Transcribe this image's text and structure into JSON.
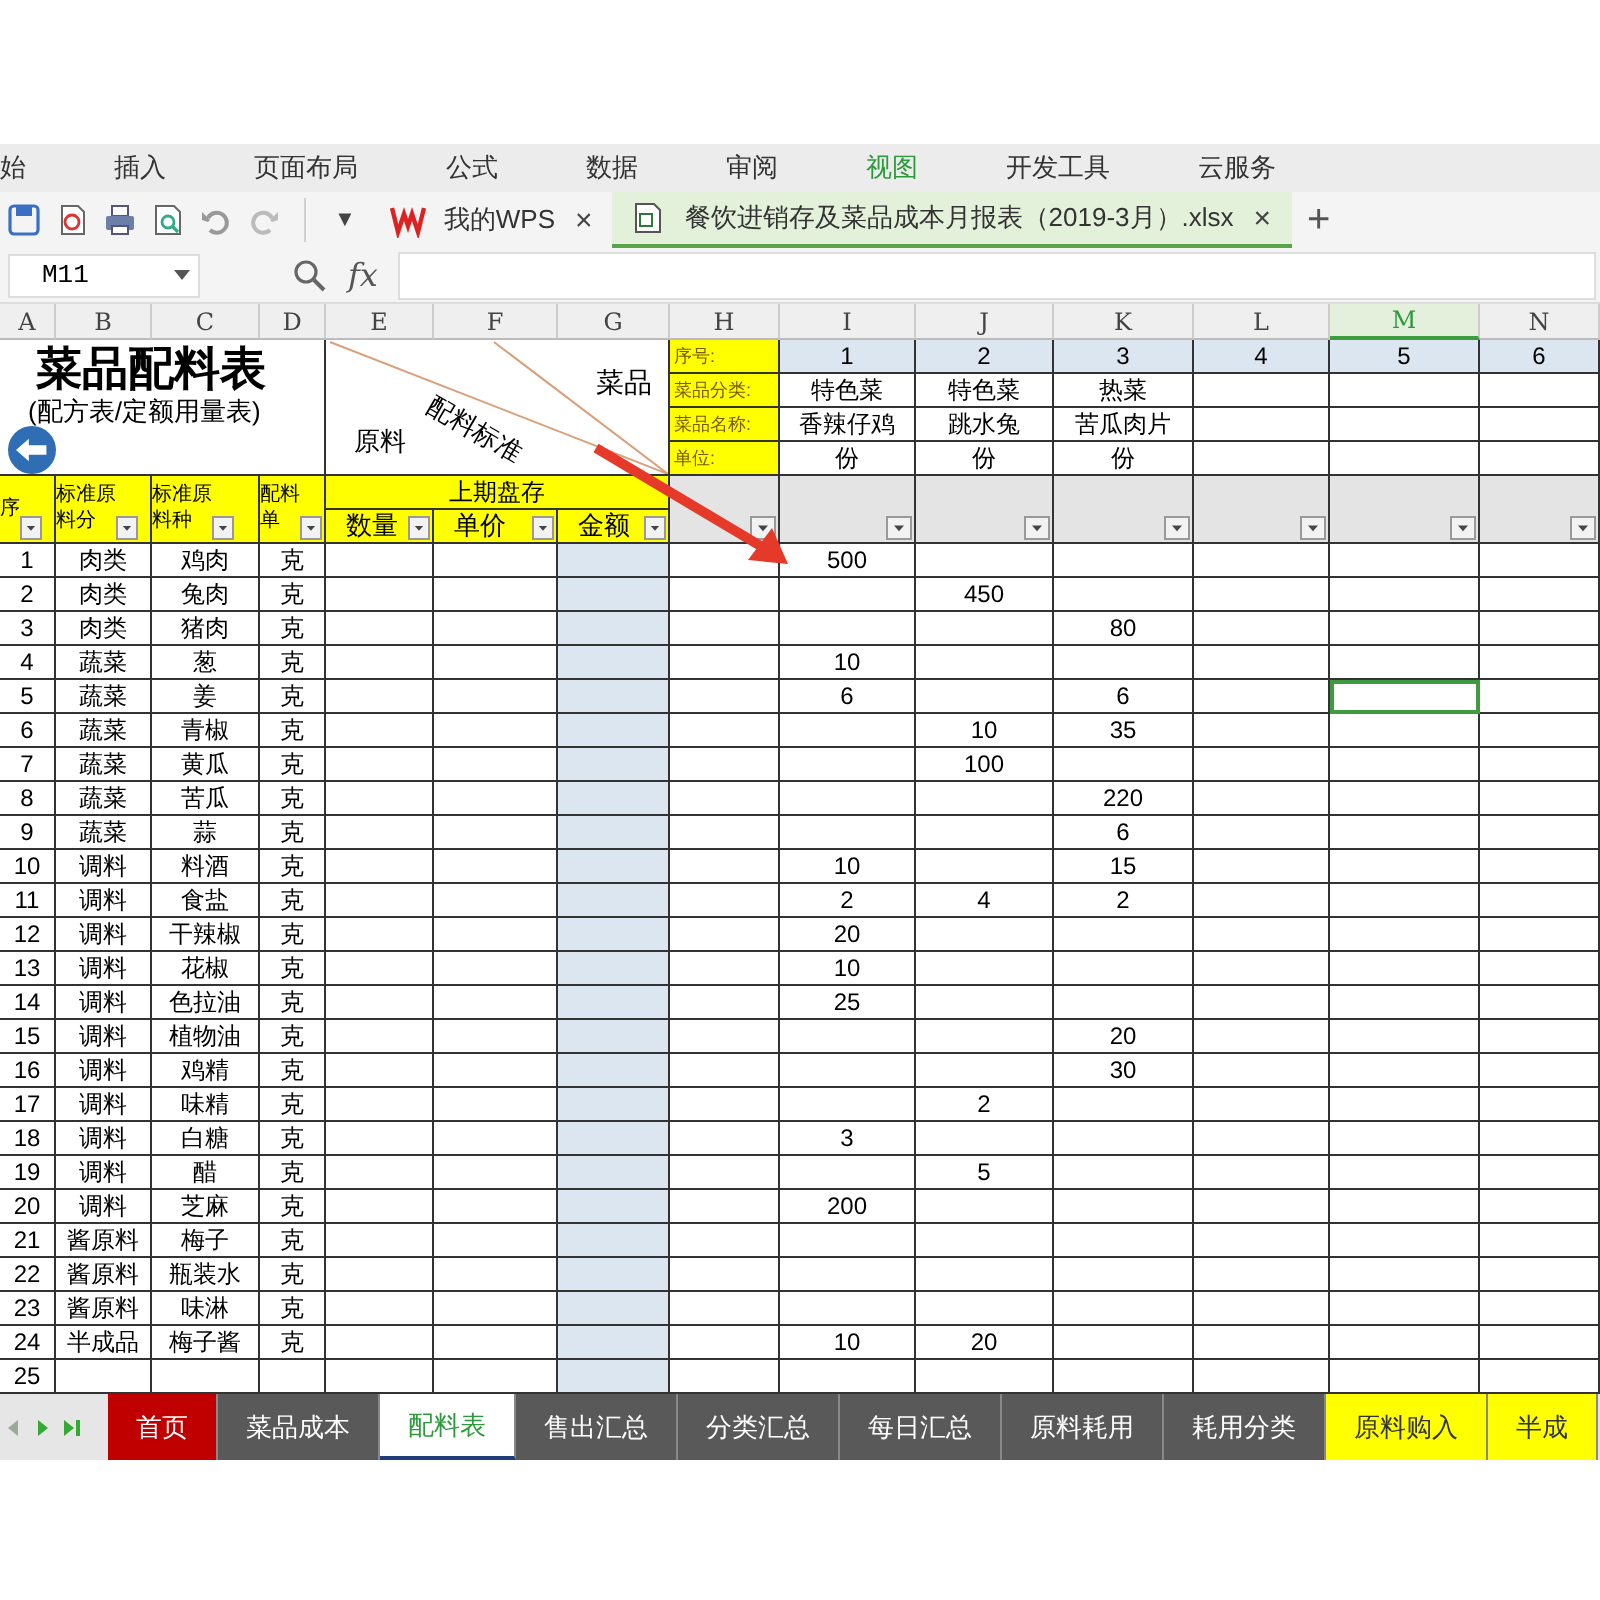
{
  "menu": [
    {
      "label": "始",
      "selected": false
    },
    {
      "label": "插入",
      "selected": false
    },
    {
      "label": "页面布局",
      "selected": false
    },
    {
      "label": "公式",
      "selected": false
    },
    {
      "label": "数据",
      "selected": false
    },
    {
      "label": "审阅",
      "selected": false
    },
    {
      "label": "视图",
      "selected": true
    },
    {
      "label": "开发工具",
      "selected": false
    },
    {
      "label": "云服务",
      "selected": false
    }
  ],
  "toolbar": {
    "more": "▼",
    "doc_tabs": [
      {
        "label": "我的WPS",
        "kind": "home",
        "selected": false,
        "close": "×"
      },
      {
        "label": "餐饮进销存及菜品成本月报表（2019-3月）.xlsx",
        "kind": "file",
        "selected": true,
        "close": "×"
      }
    ],
    "new_tab": "+"
  },
  "formula_bar": {
    "name_box": "M11",
    "fx": "fx"
  },
  "sheet": {
    "columns": [
      {
        "letter": "A",
        "selected": false
      },
      {
        "letter": "B",
        "selected": false
      },
      {
        "letter": "C",
        "selected": false
      },
      {
        "letter": "D",
        "selected": false
      },
      {
        "letter": "E",
        "selected": false
      },
      {
        "letter": "F",
        "selected": false
      },
      {
        "letter": "G",
        "selected": false
      },
      {
        "letter": "H",
        "selected": false
      },
      {
        "letter": "I",
        "selected": false
      },
      {
        "letter": "J",
        "selected": false
      },
      {
        "letter": "K",
        "selected": false
      },
      {
        "letter": "L",
        "selected": false
      },
      {
        "letter": "M",
        "selected": true
      },
      {
        "letter": "N",
        "selected": false
      }
    ],
    "title": "菜品配料表",
    "subtitle": "(配方表/定额用量表)",
    "diagonal_header": {
      "top": "菜品",
      "middle": "配料标准",
      "bottom": "原料"
    },
    "dish_labels": [
      "序号:",
      "菜品分类:",
      "菜品名称:",
      "单位:"
    ],
    "dishes": [
      {
        "no": "1",
        "category": "特色菜",
        "name": "香辣仔鸡",
        "unit": "份"
      },
      {
        "no": "2",
        "category": "特色菜",
        "name": "跳水兔",
        "unit": "份"
      },
      {
        "no": "3",
        "category": "热菜",
        "name": "苦瓜肉片",
        "unit": "份"
      },
      {
        "no": "4"
      },
      {
        "no": "5"
      },
      {
        "no": "6"
      }
    ],
    "headers": [
      [
        "序"
      ],
      [
        "标准原",
        "料分"
      ],
      [
        "标准原",
        "料种"
      ],
      [
        "配料",
        "单"
      ]
    ],
    "stock_header": "上期盘存",
    "stock_columns": [
      "数量",
      "单价",
      "金额"
    ],
    "rows": [
      {
        "no": "1",
        "category": "肉类",
        "material": "鸡肉",
        "unit": "克",
        "dish_1": "500",
        "active": false
      },
      {
        "no": "2",
        "category": "肉类",
        "material": "兔肉",
        "unit": "克",
        "dish_2": "450",
        "active": false
      },
      {
        "no": "3",
        "category": "肉类",
        "material": "猪肉",
        "unit": "克",
        "dish_3": "80",
        "active": false
      },
      {
        "no": "4",
        "category": "蔬菜",
        "material": "葱",
        "unit": "克",
        "dish_1": "10",
        "active": false
      },
      {
        "no": "5",
        "category": "蔬菜",
        "material": "姜",
        "unit": "克",
        "dish_1": "6",
        "dish_3": "6",
        "active": true
      },
      {
        "no": "6",
        "category": "蔬菜",
        "material": "青椒",
        "unit": "克",
        "dish_2": "10",
        "dish_3": "35",
        "active": false
      },
      {
        "no": "7",
        "category": "蔬菜",
        "material": "黄瓜",
        "unit": "克",
        "dish_2": "100",
        "active": false
      },
      {
        "no": "8",
        "category": "蔬菜",
        "material": "苦瓜",
        "unit": "克",
        "dish_3": "220",
        "active": false
      },
      {
        "no": "9",
        "category": "蔬菜",
        "material": "蒜",
        "unit": "克",
        "dish_3": "6",
        "active": false
      },
      {
        "no": "10",
        "category": "调料",
        "material": "料酒",
        "unit": "克",
        "dish_1": "10",
        "dish_3": "15",
        "active": false
      },
      {
        "no": "11",
        "category": "调料",
        "material": "食盐",
        "unit": "克",
        "dish_1": "2",
        "dish_2": "4",
        "dish_3": "2",
        "active": false
      },
      {
        "no": "12",
        "category": "调料",
        "material": "干辣椒",
        "unit": "克",
        "dish_1": "20",
        "active": false
      },
      {
        "no": "13",
        "category": "调料",
        "material": "花椒",
        "unit": "克",
        "dish_1": "10",
        "active": false
      },
      {
        "no": "14",
        "category": "调料",
        "material": "色拉油",
        "unit": "克",
        "dish_1": "25",
        "active": false
      },
      {
        "no": "15",
        "category": "调料",
        "material": "植物油",
        "unit": "克",
        "dish_3": "20",
        "active": false
      },
      {
        "no": "16",
        "category": "调料",
        "material": "鸡精",
        "unit": "克",
        "dish_3": "30",
        "active": false
      },
      {
        "no": "17",
        "category": "调料",
        "material": "味精",
        "unit": "克",
        "dish_2": "2",
        "active": false
      },
      {
        "no": "18",
        "category": "调料",
        "material": "白糖",
        "unit": "克",
        "dish_1": "3",
        "active": false
      },
      {
        "no": "19",
        "category": "调料",
        "material": "醋",
        "unit": "克",
        "dish_2": "5",
        "active": false
      },
      {
        "no": "20",
        "category": "调料",
        "material": "芝麻",
        "unit": "克",
        "dish_1": "200",
        "active": false
      },
      {
        "no": "21",
        "category": "酱原料",
        "material": "梅子",
        "unit": "克",
        "active": false
      },
      {
        "no": "22",
        "category": "酱原料",
        "material": "瓶装水",
        "unit": "克",
        "active": false
      },
      {
        "no": "23",
        "category": "酱原料",
        "material": "味淋",
        "unit": "克",
        "active": false
      },
      {
        "no": "24",
        "category": "半成品",
        "material": "梅子酱",
        "unit": "克",
        "dish_1": "10",
        "dish_2": "20",
        "active": false
      },
      {
        "no": "25",
        "active": false
      }
    ]
  },
  "sheet_tabs": [
    {
      "label": "首页",
      "color": "#c00000",
      "selected": false
    },
    {
      "label": "菜品成本",
      "color": "#595959",
      "selected": false
    },
    {
      "label": "配料表",
      "color": "#ffffff",
      "selected": true
    },
    {
      "label": "售出汇总",
      "color": "#595959",
      "selected": false
    },
    {
      "label": "分类汇总",
      "color": "#595959",
      "selected": false
    },
    {
      "label": "每日汇总",
      "color": "#595959",
      "selected": false
    },
    {
      "label": "原料耗用",
      "color": "#595959",
      "selected": false
    },
    {
      "label": "耗用分类",
      "color": "#595959",
      "selected": false
    },
    {
      "label": "原料购入",
      "color": "#ffff00",
      "selected": false
    },
    {
      "label": "半成",
      "color": "#ffff00",
      "selected": false
    }
  ]
}
